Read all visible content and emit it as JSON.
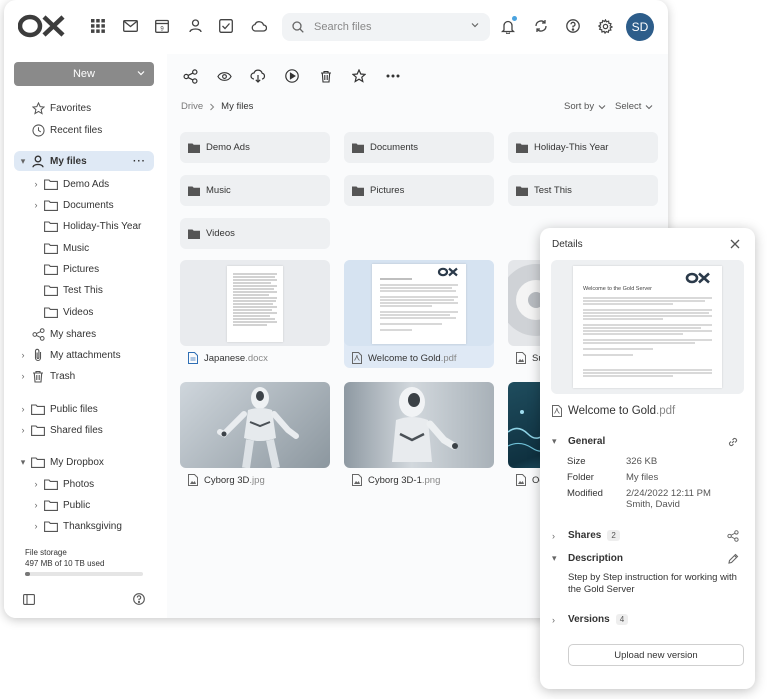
{
  "header": {
    "search_placeholder": "Search files",
    "avatar_initials": "SD",
    "accent": "#2d5d8a"
  },
  "toolbar": {
    "new_label": "New",
    "icons": [
      "share-icon",
      "view-icon",
      "download-icon",
      "play-icon",
      "trash-icon",
      "star-icon",
      "more-icon"
    ]
  },
  "sidebar": {
    "items": [
      {
        "label": "Favorites",
        "icon": "star-icon"
      },
      {
        "label": "Recent files",
        "icon": "clock-icon"
      },
      {
        "label": "My files",
        "icon": "user-icon"
      },
      {
        "label": "Demo Ads",
        "icon": "folder-icon"
      },
      {
        "label": "Documents",
        "icon": "folder-icon"
      },
      {
        "label": "Holiday-This Year",
        "icon": "folder-icon"
      },
      {
        "label": "Music",
        "icon": "folder-icon"
      },
      {
        "label": "Pictures",
        "icon": "folder-icon"
      },
      {
        "label": "Test This",
        "icon": "folder-icon"
      },
      {
        "label": "Videos",
        "icon": "folder-icon"
      },
      {
        "label": "My shares",
        "icon": "share-icon"
      },
      {
        "label": "My attachments",
        "icon": "paperclip-icon"
      },
      {
        "label": "Trash",
        "icon": "trash-icon"
      },
      {
        "label": "Public files",
        "icon": "folder-icon"
      },
      {
        "label": "Shared files",
        "icon": "folder-icon"
      },
      {
        "label": "My Dropbox",
        "icon": "folder-icon"
      },
      {
        "label": "Photos",
        "icon": "folder-icon"
      },
      {
        "label": "Public",
        "icon": "folder-icon"
      },
      {
        "label": "Thanksgiving",
        "icon": "folder-icon"
      }
    ],
    "storage_label": "File storage",
    "storage_usage": "497 MB of 10 TB used",
    "storage_fraction": 0.04
  },
  "main": {
    "breadcrumb_root": "Drive",
    "breadcrumb_current": "My files",
    "sort_label": "Sort by",
    "select_label": "Select",
    "folders": [
      "Demo Ads",
      "Documents",
      "Holiday-This Year",
      "Music",
      "Pictures",
      "Test This",
      "Videos"
    ],
    "files": [
      {
        "name": "Japanese",
        "ext": ".docx"
      },
      {
        "name": "Welcome to Gold",
        "ext": ".pdf"
      },
      {
        "name": "Sush",
        "ext": ""
      },
      {
        "name": "Cyborg 3D",
        "ext": ".jpg"
      },
      {
        "name": "Cyborg 3D-1",
        "ext": ".png"
      },
      {
        "name": "Ocea",
        "ext": ""
      }
    ]
  },
  "details": {
    "title": "Details",
    "preview_heading": "Welcome to the Gold Server",
    "file_name": "Welcome to Gold",
    "file_ext": ".pdf",
    "general_label": "General",
    "size_key": "Size",
    "size_val": "326 KB",
    "folder_key": "Folder",
    "folder_val": "My files",
    "modified_key": "Modified",
    "modified_val": "2/24/2022 12:11 PM",
    "modified_by": "Smith, David",
    "shares_label": "Shares",
    "shares_count": "2",
    "description_label": "Description",
    "description_text": "Step by Step instruction for working with the Gold Server",
    "versions_label": "Versions",
    "versions_count": "4",
    "upload_label": "Upload new version"
  }
}
